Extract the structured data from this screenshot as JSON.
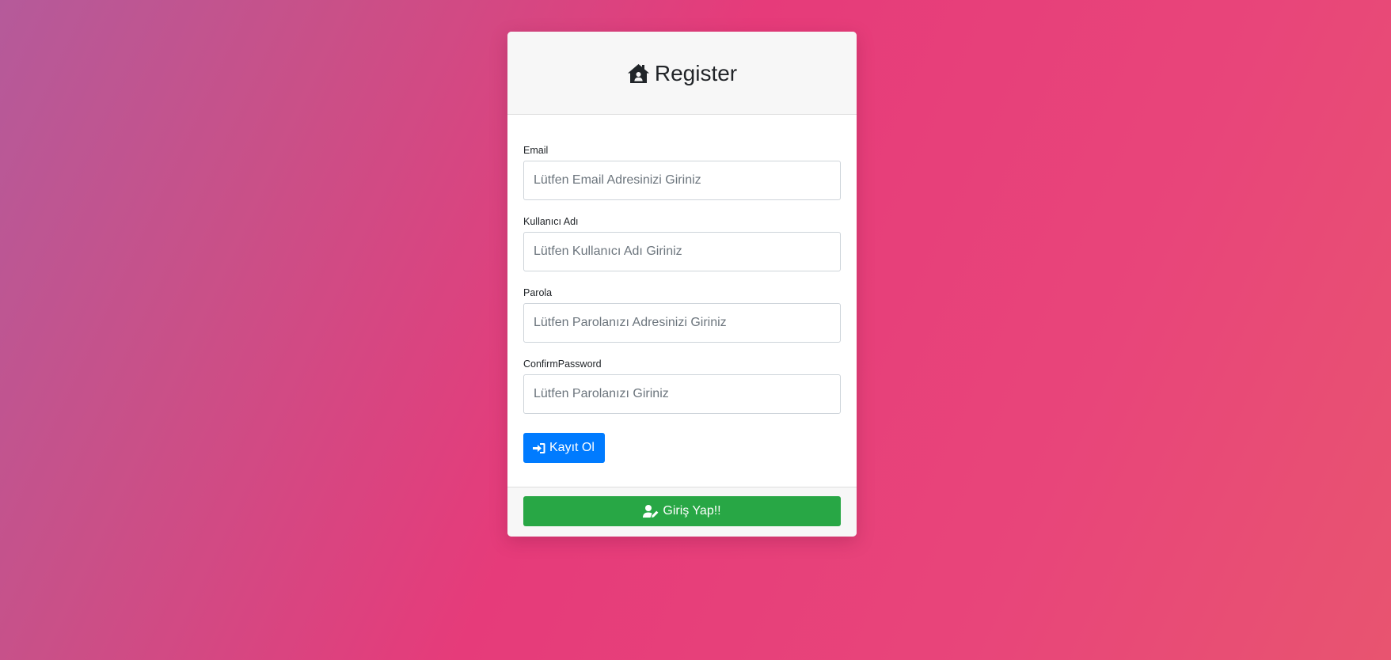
{
  "card": {
    "title": "Register",
    "title_icon": "house-user-icon"
  },
  "form": {
    "email": {
      "label": "Email",
      "placeholder": "Lütfen Email Adresinizi Giriniz",
      "value": ""
    },
    "username": {
      "label": "Kullanıcı Adı",
      "placeholder": "Lütfen Kullanıcı Adı Giriniz",
      "value": ""
    },
    "password": {
      "label": "Parola",
      "placeholder": "Lütfen Parolanızı Adresinizi Giriniz",
      "value": ""
    },
    "confirm_password": {
      "label": "ConfirmPassword",
      "placeholder": "Lütfen Parolanızı Giriniz",
      "value": ""
    },
    "submit": {
      "label": "Kayıt Ol",
      "icon": "sign-in-icon"
    }
  },
  "footer": {
    "login_button": {
      "label": "Giriş Yap!!",
      "icon": "user-edit-icon"
    }
  },
  "colors": {
    "primary": "#007bff",
    "success": "#28a745",
    "background_gradient_start": "#b55a9a",
    "background_gradient_mid": "#e63b7a",
    "background_gradient_end": "#e85470"
  }
}
